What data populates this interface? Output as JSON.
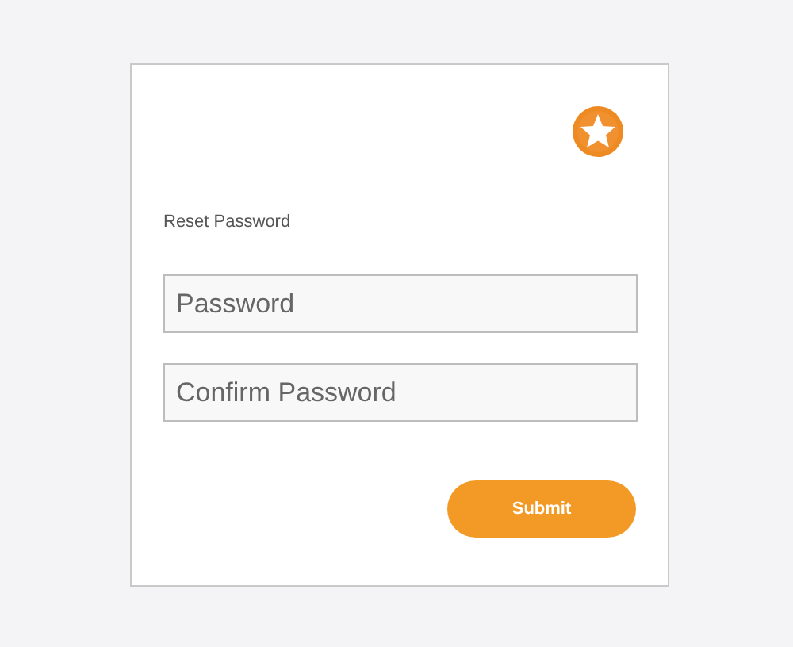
{
  "form": {
    "title": "Reset Password",
    "fields": [
      {
        "placeholder": "Password"
      },
      {
        "placeholder": "Confirm Password"
      }
    ],
    "submit_button": "Submit"
  }
}
